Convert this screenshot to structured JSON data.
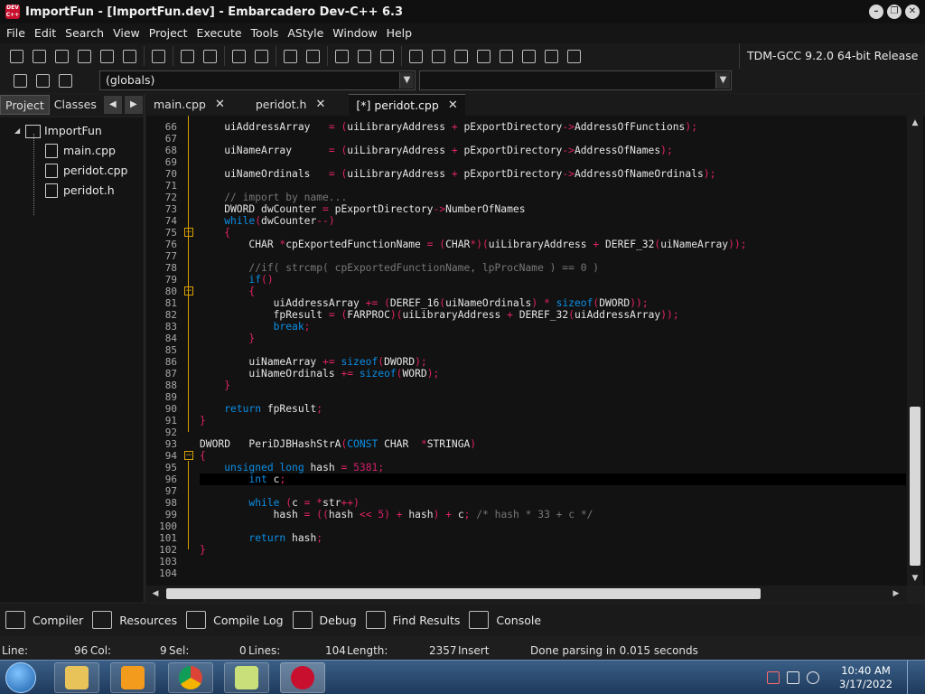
{
  "window": {
    "title": "ImportFun - [ImportFun.dev] - Embarcadero Dev-C++ 6.3",
    "logo_text": "DEV C++",
    "controls": [
      "–",
      "❐",
      "✕"
    ]
  },
  "menu": [
    "File",
    "Edit",
    "Search",
    "View",
    "Project",
    "Execute",
    "Tools",
    "AStyle",
    "Window",
    "Help"
  ],
  "toolbar": {
    "compiler": "TDM-GCC 9.2.0 64-bit Release",
    "scope_combo": "(globals)",
    "function_combo": ""
  },
  "left_panel": {
    "tabs": [
      "Project",
      "Classes"
    ],
    "active_tab": "Project",
    "project": "ImportFun",
    "files": [
      "main.cpp",
      "peridot.cpp",
      "peridot.h"
    ]
  },
  "editor_tabs": [
    {
      "label": "main.cpp",
      "close": "✕"
    },
    {
      "label": "peridot.h",
      "close": "✕"
    },
    {
      "label": "[*] peridot.cpp",
      "close": "✕",
      "active": true
    }
  ],
  "code": {
    "first_line": 66,
    "current_line": 96,
    "lines": [
      "    uiAddressArray   = (uiLibraryAddress + pExportDirectory->AddressOfFunctions);",
      "",
      "    uiNameArray      = (uiLibraryAddress + pExportDirectory->AddressOfNames);",
      "",
      "    uiNameOrdinals   = (uiLibraryAddress + pExportDirectory->AddressOfNameOrdinals);",
      "",
      "    // import by name...",
      "    DWORD dwCounter = pExportDirectory->NumberOfNames",
      "    while(dwCounter--)",
      "    {",
      "        CHAR *cpExportedFunctionName = (CHAR*)(uiLibraryAddress + DEREF_32(uiNameArray));",
      "",
      "        //if( strcmp( cpExportedFunctionName, lpProcName ) == 0 )",
      "        if()",
      "        {",
      "            uiAddressArray += (DEREF_16(uiNameOrdinals) * sizeof(DWORD));",
      "            fpResult = (FARPROC)(uiLibraryAddress + DEREF_32(uiAddressArray));",
      "            break;",
      "        }",
      "",
      "        uiNameArray += sizeof(DWORD);",
      "        uiNameOrdinals += sizeof(WORD);",
      "    }",
      "",
      "    return fpResult;",
      "}",
      "",
      "DWORD   PeriDJBHashStrA(CONST CHAR  *STRINGA)",
      "{",
      "    unsigned long hash = 5381;",
      "        int c;",
      "",
      "        while (c = *str++)",
      "            hash = ((hash << 5) + hash) + c; /* hash * 33 + c */",
      "",
      "        return hash;",
      "}",
      "",
      ""
    ]
  },
  "bottom_tabs": [
    "Compiler",
    "Resources",
    "Compile Log",
    "Debug",
    "Find Results",
    "Console"
  ],
  "status": {
    "line_label": "Line:",
    "line_value": "96",
    "col_label": "Col:",
    "col_value": "9",
    "sel_label": "Sel:",
    "sel_value": "0",
    "lines_label": "Lines:",
    "lines_value": "104",
    "length_label": "Length:",
    "length_value": "2357",
    "mode": "Insert",
    "message": "Done parsing in 0.015 seconds"
  },
  "taskbar": {
    "time": "10:40 AM",
    "date": "3/17/2022",
    "apps": [
      "file-explorer",
      "media-player",
      "chrome",
      "notepad",
      "dev-cpp"
    ]
  },
  "colors": {
    "keyword": "#0a8fe6",
    "operator": "#e0245e",
    "number": "#d01f6b",
    "comment": "#777777",
    "fold": "#d9a000"
  }
}
